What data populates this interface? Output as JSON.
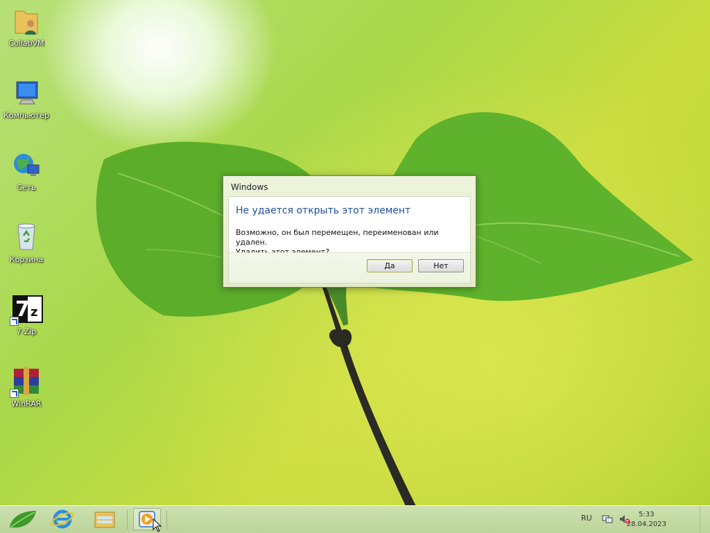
{
  "desktop": {
    "icons": [
      {
        "label": "CollabVM",
        "icon": "user-folder-icon"
      },
      {
        "label": "Компьютер",
        "icon": "computer-icon"
      },
      {
        "label": "Сеть",
        "icon": "network-globe-icon"
      },
      {
        "label": "Корзина",
        "icon": "recycle-bin-icon"
      },
      {
        "label": "7-Zip",
        "icon": "7zip-icon"
      },
      {
        "label": "WinRAR",
        "icon": "winrar-icon"
      }
    ]
  },
  "dialog": {
    "title": "Windows",
    "main_instruction": "Не удается открыть этот элемент",
    "content_line1": "Возможно, он был перемещен, переименован или удален.",
    "content_line2": "Удалить этот элемент?",
    "yes_label": "Да",
    "no_label": "Нет"
  },
  "taskbar": {
    "items": [
      "start-leaf-icon",
      "internet-explorer-icon",
      "file-explorer-icon",
      "media-player-icon"
    ],
    "language": "RU",
    "time": "5:33",
    "date": "28.04.2023"
  },
  "colors": {
    "dialog_heading": "#1e4f9a",
    "taskbar": "#c6dcaa"
  }
}
